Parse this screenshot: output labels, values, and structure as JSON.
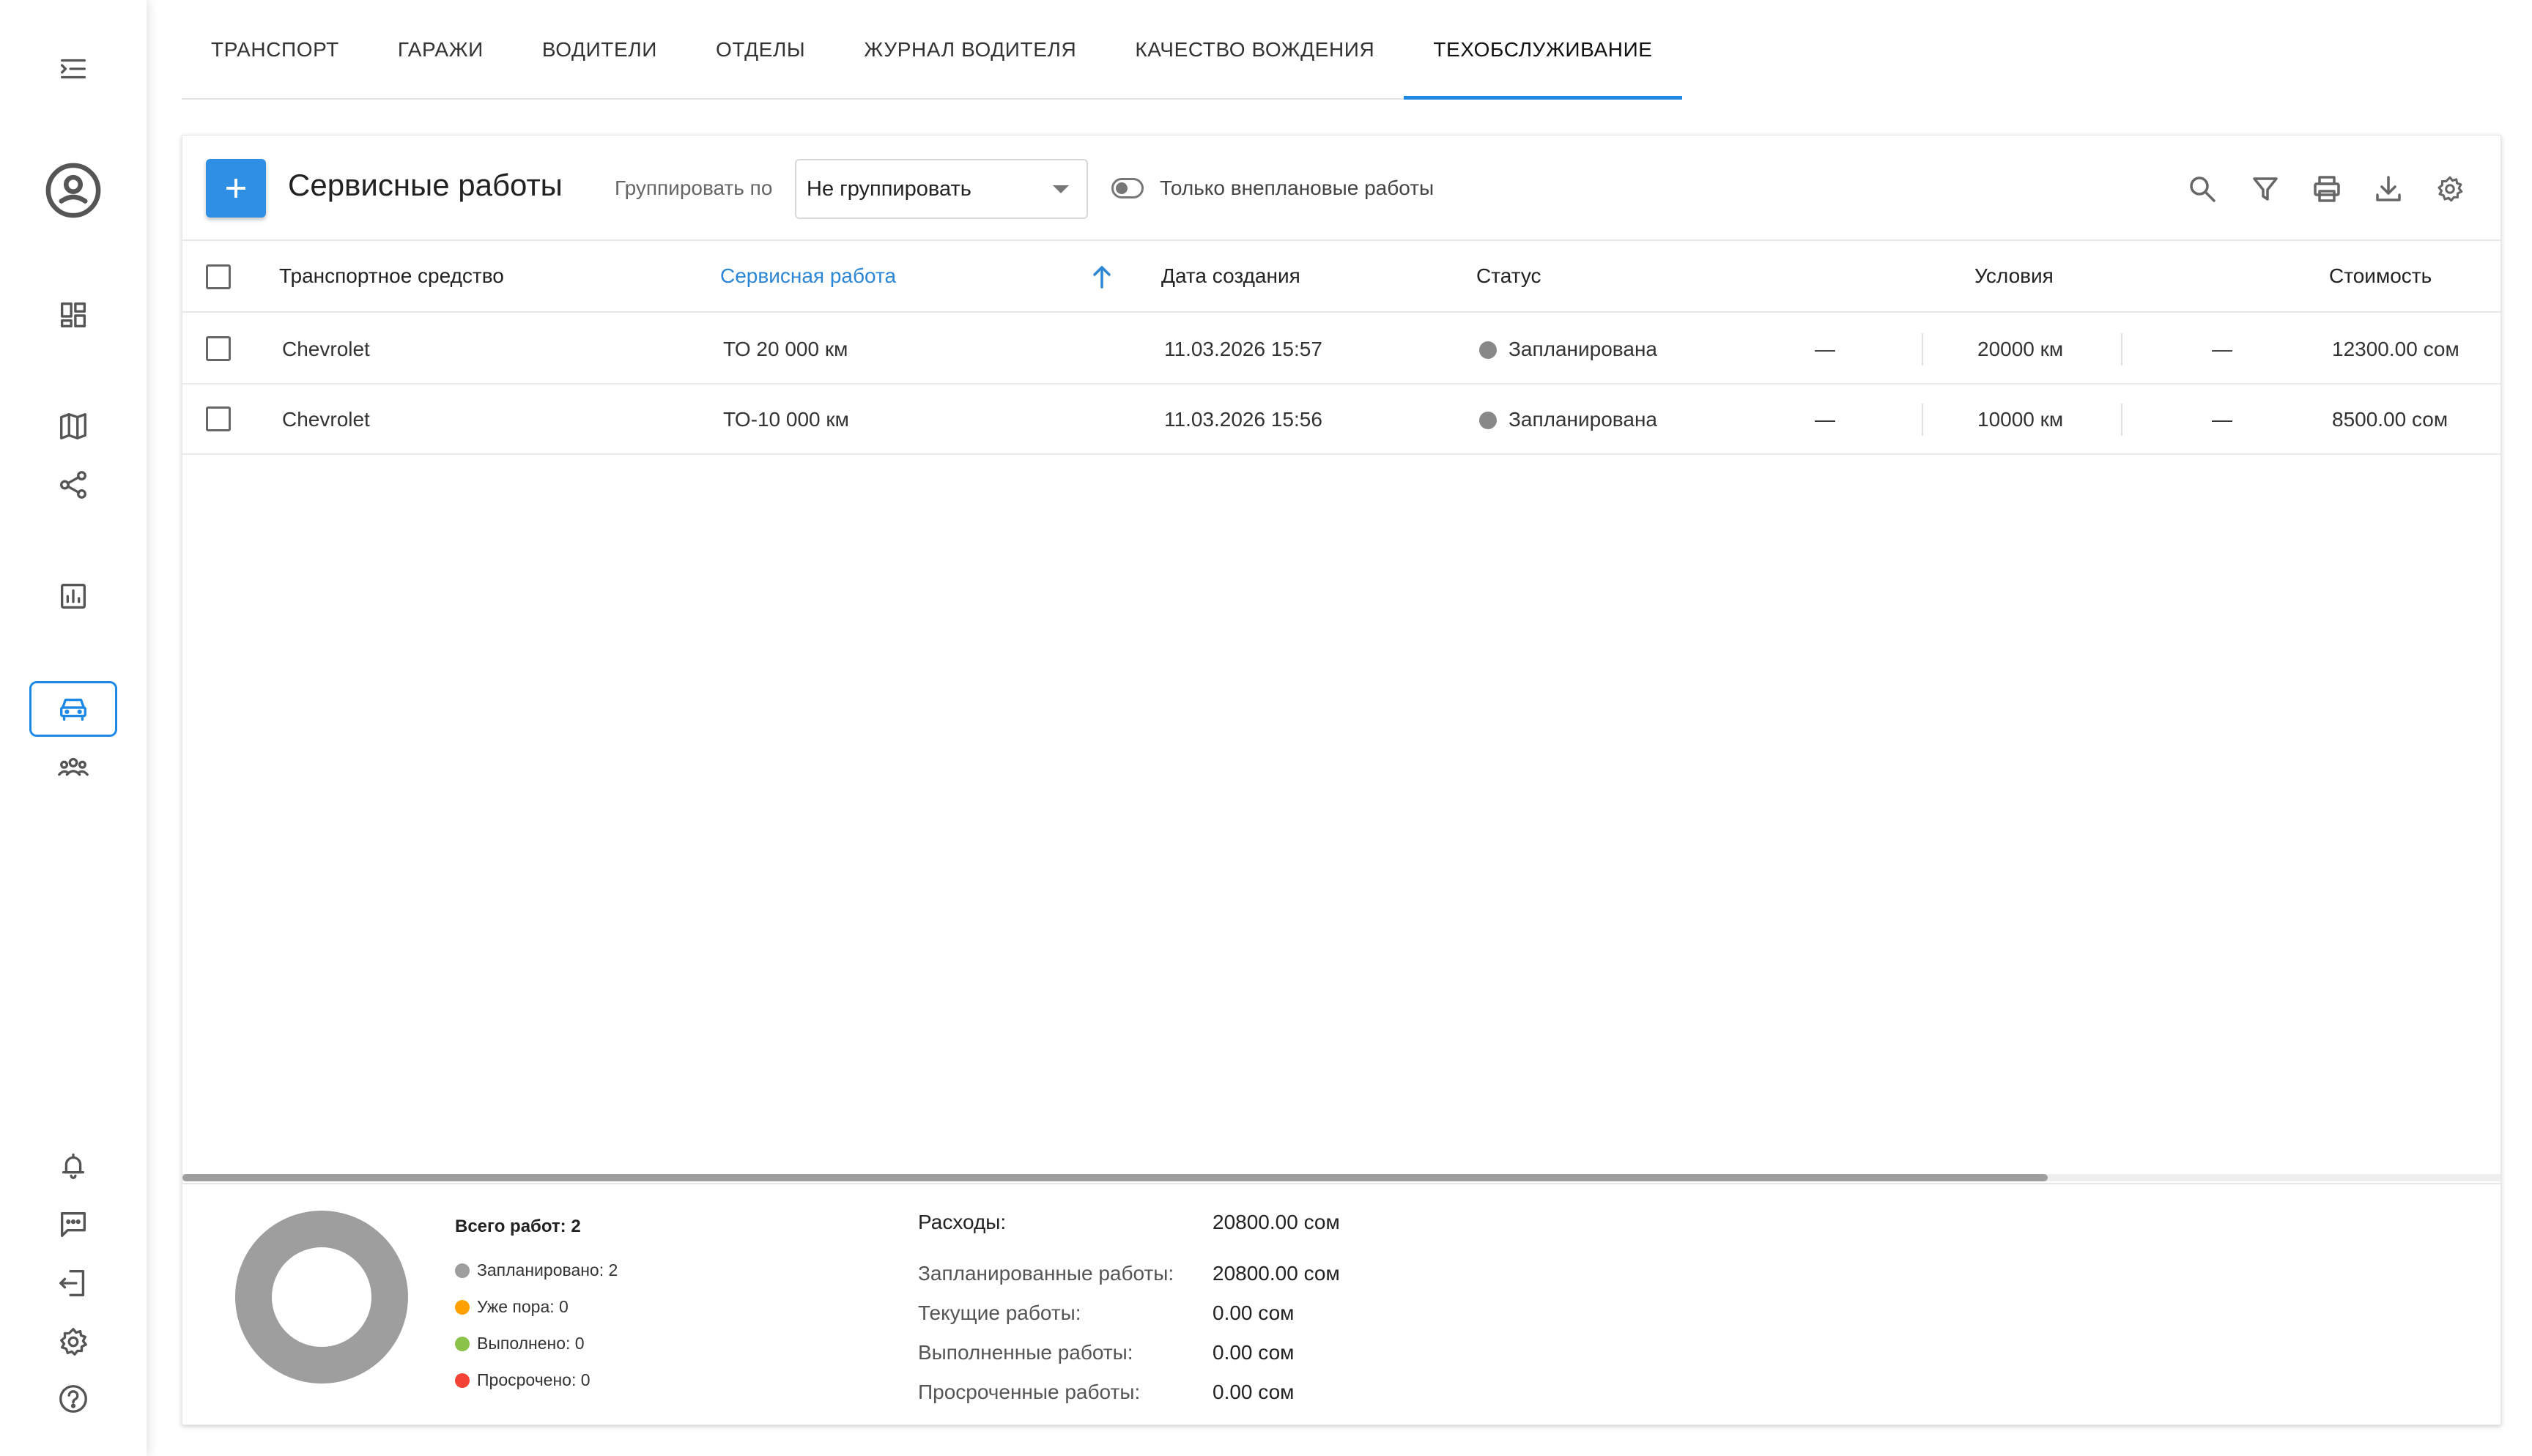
{
  "tabs": [
    {
      "label": "ТРАНСПОРТ"
    },
    {
      "label": "ГАРАЖИ"
    },
    {
      "label": "ВОДИТЕЛИ"
    },
    {
      "label": "ОТДЕЛЫ"
    },
    {
      "label": "ЖУРНАЛ ВОДИТЕЛЯ"
    },
    {
      "label": "КАЧЕСТВО ВОЖДЕНИЯ"
    },
    {
      "label": "ТЕХОБСЛУЖИВАНИЕ",
      "active": true
    }
  ],
  "sidebar": {
    "top_icons": [
      "menu-collapse-icon",
      "account-circle-icon",
      "dashboard-icon",
      "map-icon",
      "share-icon",
      "reports-chart-icon",
      "car-icon",
      "group-icon"
    ],
    "bottom_icons": [
      "bell-icon",
      "chat-icon",
      "logout-icon",
      "gear-icon",
      "help-icon"
    ],
    "active": "car-icon"
  },
  "toolbar": {
    "title": "Сервисные работы",
    "group_label": "Группировать по",
    "group_value": "Не группировать",
    "toggle_label": "Только внеплановые работы",
    "toggle_on": false,
    "icons": [
      "search-icon",
      "filter-icon",
      "print-icon",
      "download-icon",
      "gear-icon"
    ]
  },
  "table": {
    "headers": {
      "vehicle": "Транспортное средство",
      "service": "Сервисная работа",
      "created": "Дата создания",
      "status": "Статус",
      "conditions": "Условия",
      "cost": "Стоимость"
    },
    "sorted_column": "service",
    "sort_direction": "asc",
    "rows": [
      {
        "vehicle": "Chevrolet",
        "service": "ТО 20 000 км",
        "created": "11.03.2026 15:57",
        "status": "Запланирована",
        "cond1": "—",
        "cond2": "20000 км",
        "cond3": "—",
        "cost": "12300.00 сом"
      },
      {
        "vehicle": "Chevrolet",
        "service": "ТО-10 000 км",
        "created": "11.03.2026 15:56",
        "status": "Запланирована",
        "cond1": "—",
        "cond2": "10000 км",
        "cond3": "—",
        "cost": "8500.00 сом"
      }
    ],
    "scroll_fraction": 0.8
  },
  "summary": {
    "total": "Всего работ: 2",
    "legend": [
      {
        "label": "Запланировано: 2",
        "color": "#9e9e9e",
        "value": 2
      },
      {
        "label": "Уже пора: 0",
        "color": "#ffa000",
        "value": 0
      },
      {
        "label": "Выполнено: 0",
        "color": "#8bc34a",
        "value": 0
      },
      {
        "label": "Просрочено: 0",
        "color": "#f44336",
        "value": 0
      }
    ],
    "expenses": {
      "title": "Расходы:",
      "total": "20800.00 сом",
      "rows": [
        {
          "label": "Запланированные работы:",
          "value": "20800.00 сом"
        },
        {
          "label": "Текущие работы:",
          "value": "0.00 сом"
        },
        {
          "label": "Выполненные работы:",
          "value": "0.00 сом"
        },
        {
          "label": "Просроченные работы:",
          "value": "0.00 сом"
        }
      ]
    }
  },
  "colors": {
    "accent": "#1e88e5",
    "status_planned": "#888888"
  }
}
